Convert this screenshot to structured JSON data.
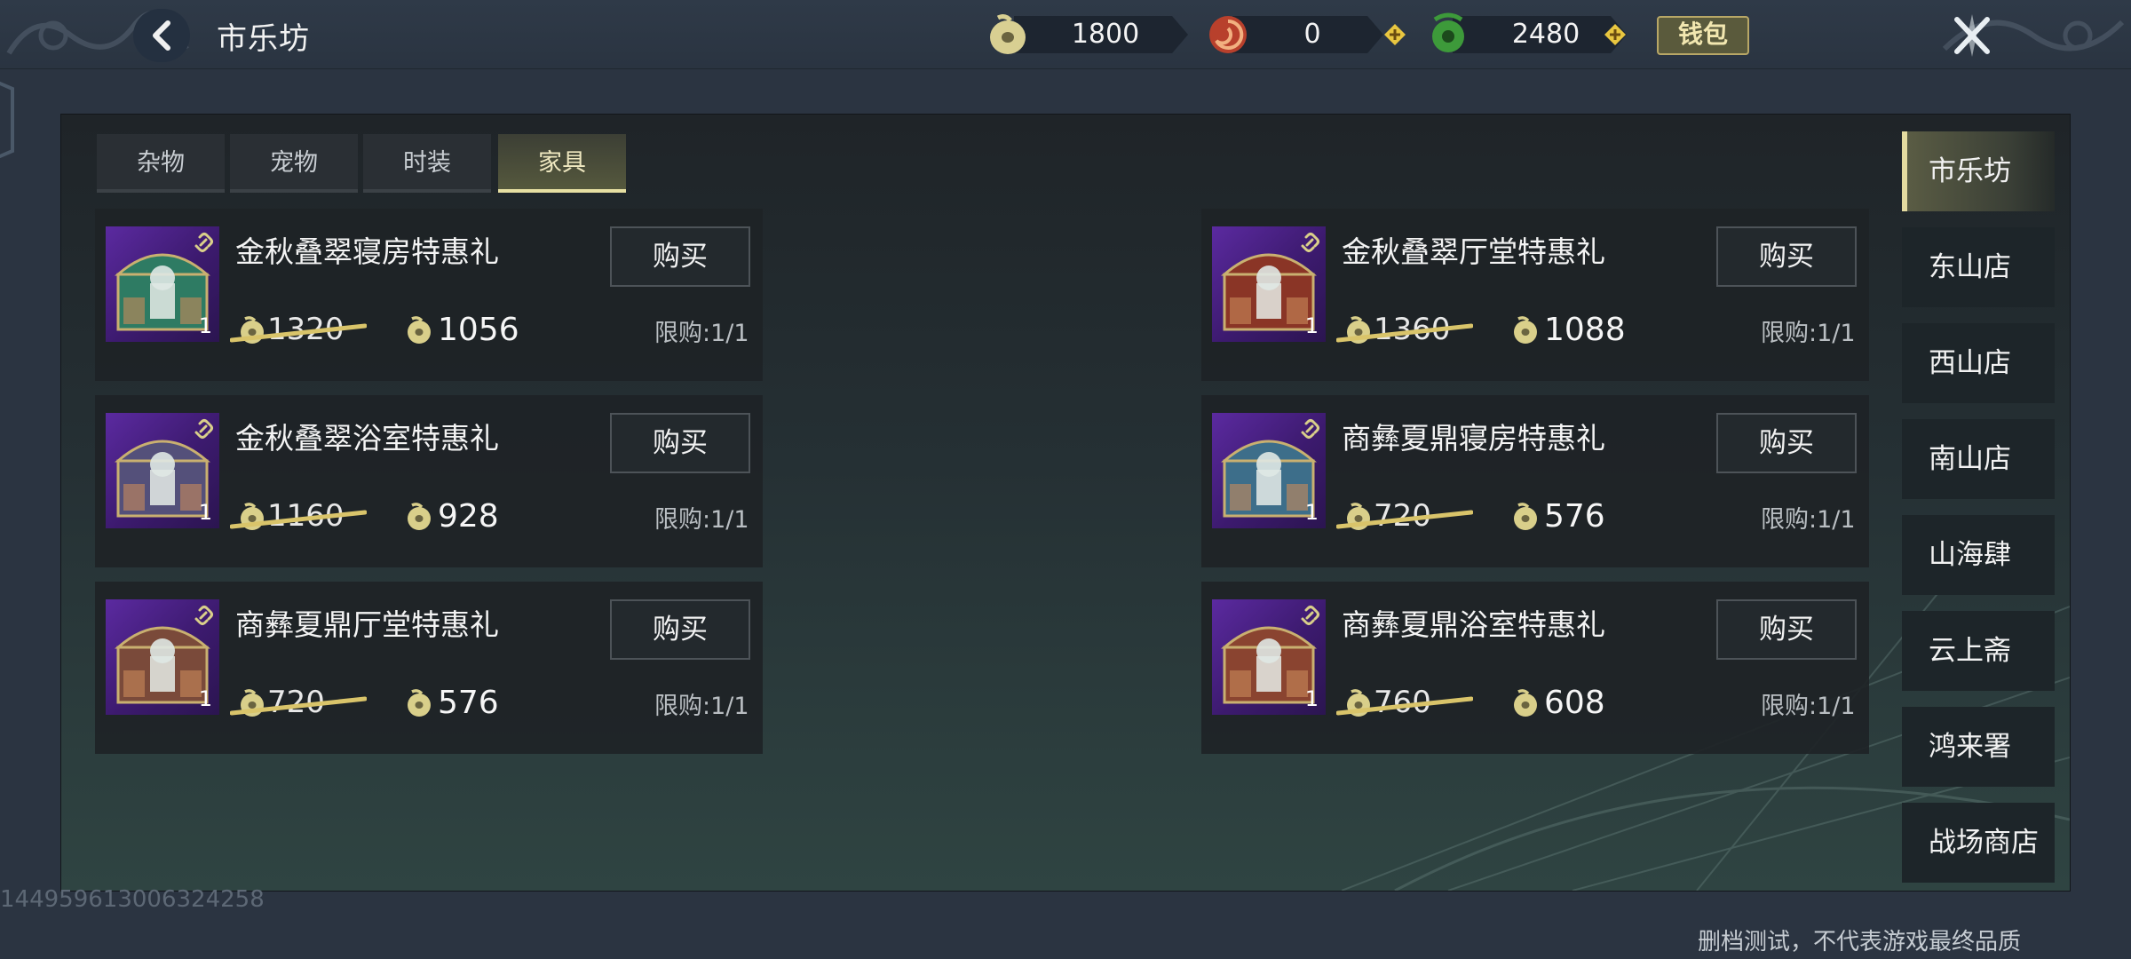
{
  "header": {
    "title": "市乐坊",
    "back_icon": "chevron-left-icon",
    "close_icon": "close-x-icon",
    "wallet_label": "钱包"
  },
  "currencies": [
    {
      "name": "jade-coin",
      "value": "1800"
    },
    {
      "name": "red-token",
      "value": "0"
    },
    {
      "name": "green-jade",
      "value": "2480"
    }
  ],
  "tabs": [
    {
      "label": "杂物",
      "active": false
    },
    {
      "label": "宠物",
      "active": false
    },
    {
      "label": "时装",
      "active": false
    },
    {
      "label": "家具",
      "active": true
    }
  ],
  "items": [
    {
      "name": "金秋叠翠寝房特惠礼",
      "qty": "1",
      "original_price": "1320",
      "price": "1056",
      "limit": "限购:1/1",
      "buy_label": "购买",
      "chest_color": "#2e7b63"
    },
    {
      "name": "金秋叠翠厅堂特惠礼",
      "qty": "1",
      "original_price": "1360",
      "price": "1088",
      "limit": "限购:1/1",
      "buy_label": "购买",
      "chest_color": "#8a3526"
    },
    {
      "name": "金秋叠翠浴室特惠礼",
      "qty": "1",
      "original_price": "1160",
      "price": "928",
      "limit": "限购:1/1",
      "buy_label": "购买",
      "chest_color": "#54507a"
    },
    {
      "name": "商彝夏鼎寝房特惠礼",
      "qty": "1",
      "original_price": "720",
      "price": "576",
      "limit": "限购:1/1",
      "buy_label": "购买",
      "chest_color": "#3d6e8a"
    },
    {
      "name": "商彝夏鼎厅堂特惠礼",
      "qty": "1",
      "original_price": "720",
      "price": "576",
      "limit": "限购:1/1",
      "buy_label": "购买",
      "chest_color": "#7a4a3a"
    },
    {
      "name": "商彝夏鼎浴室特惠礼",
      "qty": "1",
      "original_price": "760",
      "price": "608",
      "limit": "限购:1/1",
      "buy_label": "购买",
      "chest_color": "#8a4430"
    }
  ],
  "shops": [
    {
      "label": "市乐坊",
      "active": true
    },
    {
      "label": "东山店",
      "active": false
    },
    {
      "label": "西山店",
      "active": false
    },
    {
      "label": "南山店",
      "active": false
    },
    {
      "label": "山海肆",
      "active": false
    },
    {
      "label": "云上斋",
      "active": false
    },
    {
      "label": "鸿来署",
      "active": false
    },
    {
      "label": "战场商店",
      "active": false
    }
  ],
  "footer": {
    "uid": "1449596130063242​58",
    "disclaimer": "删档测试，不代表游戏最终品质"
  },
  "colors": {
    "accent_gold": "#e4dba0",
    "coin_gold": "#d9cf8a",
    "panel_bg": "#1f2428"
  }
}
